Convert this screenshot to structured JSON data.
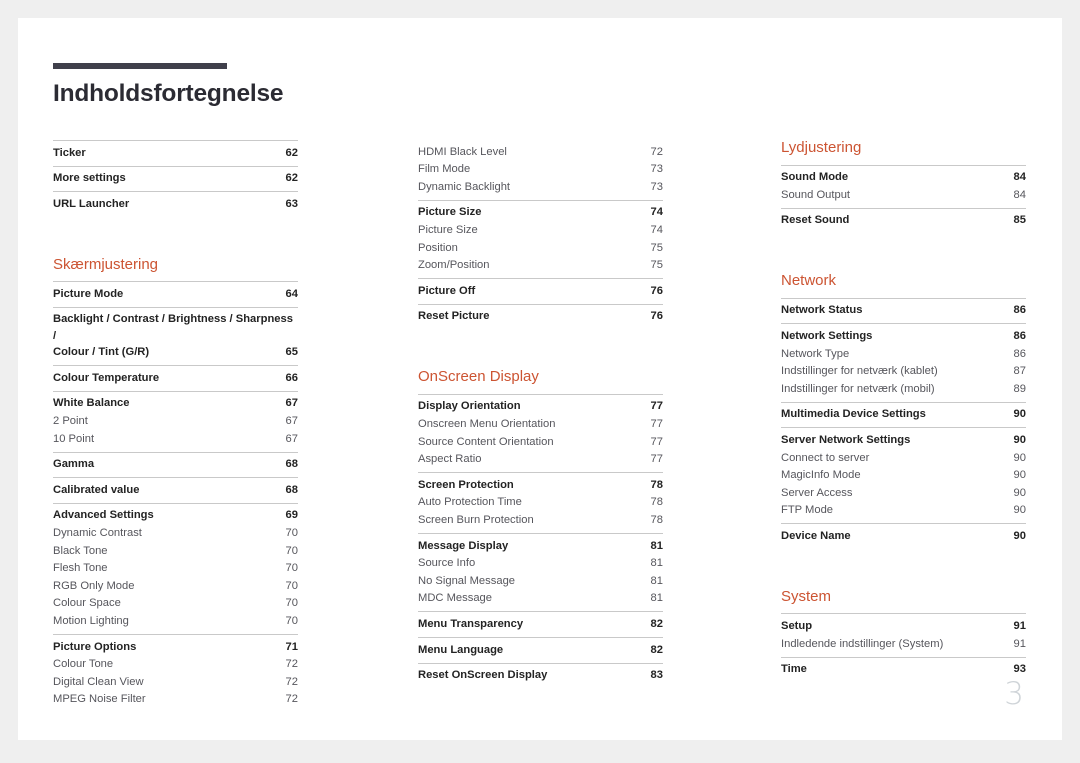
{
  "document": {
    "title": "Indholdsfortegnelse",
    "page_number": "3"
  },
  "colors": {
    "accent": "#cc5432",
    "rule": "#40404b",
    "divider": "#c9c9c9",
    "main_text": "#232323",
    "sub_text": "#56565c",
    "page_number": "#cfd4d8",
    "page_background": "#ffffff",
    "canvas_background": "#efefef"
  },
  "columns": [
    {
      "sections": [
        {
          "heading": null,
          "groups": [
            {
              "entries": [
                {
                  "label": "Ticker",
                  "page": "62",
                  "level": "main"
                }
              ]
            },
            {
              "entries": [
                {
                  "label": "More settings",
                  "page": "62",
                  "level": "main"
                }
              ]
            },
            {
              "entries": [
                {
                  "label": "URL Launcher",
                  "page": "63",
                  "level": "main"
                }
              ]
            }
          ]
        },
        {
          "heading": "Skærmjustering",
          "groups": [
            {
              "entries": [
                {
                  "label": "Picture Mode",
                  "page": "64",
                  "level": "main"
                }
              ]
            },
            {
              "entries": [
                {
                  "label": "Backlight / Contrast / Brightness / Sharpness /",
                  "label2": "Colour / Tint (G/R)",
                  "page": "65",
                  "level": "main",
                  "wrap": true
                }
              ]
            },
            {
              "entries": [
                {
                  "label": "Colour Temperature",
                  "page": "66",
                  "level": "main"
                }
              ]
            },
            {
              "entries": [
                {
                  "label": "White Balance",
                  "page": "67",
                  "level": "main"
                },
                {
                  "label": "2 Point",
                  "page": "67",
                  "level": "sub"
                },
                {
                  "label": "10 Point",
                  "page": "67",
                  "level": "sub"
                }
              ]
            },
            {
              "entries": [
                {
                  "label": "Gamma",
                  "page": "68",
                  "level": "main"
                }
              ]
            },
            {
              "entries": [
                {
                  "label": "Calibrated value",
                  "page": "68",
                  "level": "main"
                }
              ]
            },
            {
              "entries": [
                {
                  "label": "Advanced Settings",
                  "page": "69",
                  "level": "main"
                },
                {
                  "label": "Dynamic Contrast",
                  "page": "70",
                  "level": "sub"
                },
                {
                  "label": "Black Tone",
                  "page": "70",
                  "level": "sub"
                },
                {
                  "label": "Flesh Tone",
                  "page": "70",
                  "level": "sub"
                },
                {
                  "label": "RGB Only Mode",
                  "page": "70",
                  "level": "sub"
                },
                {
                  "label": "Colour Space",
                  "page": "70",
                  "level": "sub"
                },
                {
                  "label": "Motion Lighting",
                  "page": "70",
                  "level": "sub"
                }
              ]
            },
            {
              "entries": [
                {
                  "label": "Picture Options",
                  "page": "71",
                  "level": "main"
                },
                {
                  "label": "Colour Tone",
                  "page": "72",
                  "level": "sub"
                },
                {
                  "label": "Digital Clean View",
                  "page": "72",
                  "level": "sub"
                },
                {
                  "label": "MPEG Noise Filter",
                  "page": "72",
                  "level": "sub"
                }
              ]
            }
          ]
        }
      ]
    },
    {
      "sections": [
        {
          "heading": null,
          "groups": [
            {
              "no_rule": true,
              "entries": [
                {
                  "label": "HDMI Black Level",
                  "page": "72",
                  "level": "sub"
                },
                {
                  "label": "Film Mode",
                  "page": "73",
                  "level": "sub"
                },
                {
                  "label": "Dynamic Backlight",
                  "page": "73",
                  "level": "sub"
                }
              ]
            },
            {
              "entries": [
                {
                  "label": "Picture Size",
                  "page": "74",
                  "level": "main"
                },
                {
                  "label": "Picture Size",
                  "page": "74",
                  "level": "sub"
                },
                {
                  "label": "Position",
                  "page": "75",
                  "level": "sub"
                },
                {
                  "label": "Zoom/Position",
                  "page": "75",
                  "level": "sub"
                }
              ]
            },
            {
              "entries": [
                {
                  "label": "Picture Off",
                  "page": "76",
                  "level": "main"
                }
              ]
            },
            {
              "entries": [
                {
                  "label": "Reset Picture",
                  "page": "76",
                  "level": "main"
                }
              ]
            }
          ]
        },
        {
          "heading": "OnScreen Display",
          "groups": [
            {
              "entries": [
                {
                  "label": "Display Orientation",
                  "page": "77",
                  "level": "main"
                },
                {
                  "label": "Onscreen Menu Orientation",
                  "page": "77",
                  "level": "sub"
                },
                {
                  "label": "Source Content Orientation",
                  "page": "77",
                  "level": "sub"
                },
                {
                  "label": "Aspect Ratio",
                  "page": "77",
                  "level": "sub"
                }
              ]
            },
            {
              "entries": [
                {
                  "label": "Screen Protection",
                  "page": "78",
                  "level": "main"
                },
                {
                  "label": "Auto Protection Time",
                  "page": "78",
                  "level": "sub"
                },
                {
                  "label": "Screen Burn Protection",
                  "page": "78",
                  "level": "sub"
                }
              ]
            },
            {
              "entries": [
                {
                  "label": "Message Display",
                  "page": "81",
                  "level": "main"
                },
                {
                  "label": "Source Info",
                  "page": "81",
                  "level": "sub"
                },
                {
                  "label": "No Signal Message",
                  "page": "81",
                  "level": "sub"
                },
                {
                  "label": "MDC Message",
                  "page": "81",
                  "level": "sub"
                }
              ]
            },
            {
              "entries": [
                {
                  "label": "Menu Transparency",
                  "page": "82",
                  "level": "main"
                }
              ]
            },
            {
              "entries": [
                {
                  "label": "Menu Language",
                  "page": "82",
                  "level": "main"
                }
              ]
            },
            {
              "entries": [
                {
                  "label": "Reset OnScreen Display",
                  "page": "83",
                  "level": "main"
                }
              ]
            }
          ]
        }
      ]
    },
    {
      "sections": [
        {
          "heading": "Lydjustering",
          "groups": [
            {
              "entries": [
                {
                  "label": "Sound Mode",
                  "page": "84",
                  "level": "main"
                },
                {
                  "label": "Sound Output",
                  "page": "84",
                  "level": "sub"
                }
              ]
            },
            {
              "entries": [
                {
                  "label": "Reset Sound",
                  "page": "85",
                  "level": "main"
                }
              ]
            }
          ]
        },
        {
          "heading": "Network",
          "groups": [
            {
              "entries": [
                {
                  "label": "Network Status",
                  "page": "86",
                  "level": "main"
                }
              ]
            },
            {
              "entries": [
                {
                  "label": "Network Settings",
                  "page": "86",
                  "level": "main"
                },
                {
                  "label": "Network Type",
                  "page": "86",
                  "level": "sub"
                },
                {
                  "label": "Indstillinger for netværk (kablet)",
                  "page": "87",
                  "level": "sub"
                },
                {
                  "label": "Indstillinger for netværk (mobil)",
                  "page": "89",
                  "level": "sub"
                }
              ]
            },
            {
              "entries": [
                {
                  "label": "Multimedia Device Settings",
                  "page": "90",
                  "level": "main"
                }
              ]
            },
            {
              "entries": [
                {
                  "label": "Server Network Settings",
                  "page": "90",
                  "level": "main"
                },
                {
                  "label": "Connect to server",
                  "page": "90",
                  "level": "sub"
                },
                {
                  "label": "MagicInfo Mode",
                  "page": "90",
                  "level": "sub"
                },
                {
                  "label": "Server Access",
                  "page": "90",
                  "level": "sub"
                },
                {
                  "label": "FTP Mode",
                  "page": "90",
                  "level": "sub"
                }
              ]
            },
            {
              "entries": [
                {
                  "label": "Device Name",
                  "page": "90",
                  "level": "main"
                }
              ]
            }
          ]
        },
        {
          "heading": "System",
          "groups": [
            {
              "entries": [
                {
                  "label": "Setup",
                  "page": "91",
                  "level": "main"
                },
                {
                  "label": "Indledende indstillinger (System)",
                  "page": "91",
                  "level": "sub"
                }
              ]
            },
            {
              "entries": [
                {
                  "label": "Time",
                  "page": "93",
                  "level": "main"
                }
              ]
            }
          ]
        }
      ]
    }
  ]
}
